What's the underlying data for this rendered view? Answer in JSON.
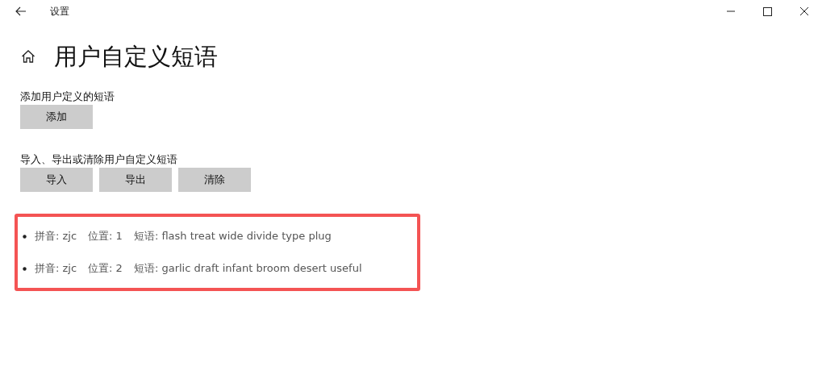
{
  "window": {
    "title": "设置"
  },
  "page": {
    "title": "用户自定义短语"
  },
  "sections": [
    {
      "label": "添加用户定义的短语",
      "buttons": [
        "添加"
      ]
    },
    {
      "label": "导入、导出或清除用户自定义短语",
      "buttons": [
        "导入",
        "导出",
        "清除"
      ]
    }
  ],
  "phrases": [
    {
      "pinyin": "拼音: zjc",
      "position": "位置: 1",
      "phrase": "短语: flash treat wide divide type plug"
    },
    {
      "pinyin": "拼音: zjc",
      "position": "位置: 2",
      "phrase": "短语: garlic draft infant broom desert useful"
    }
  ]
}
